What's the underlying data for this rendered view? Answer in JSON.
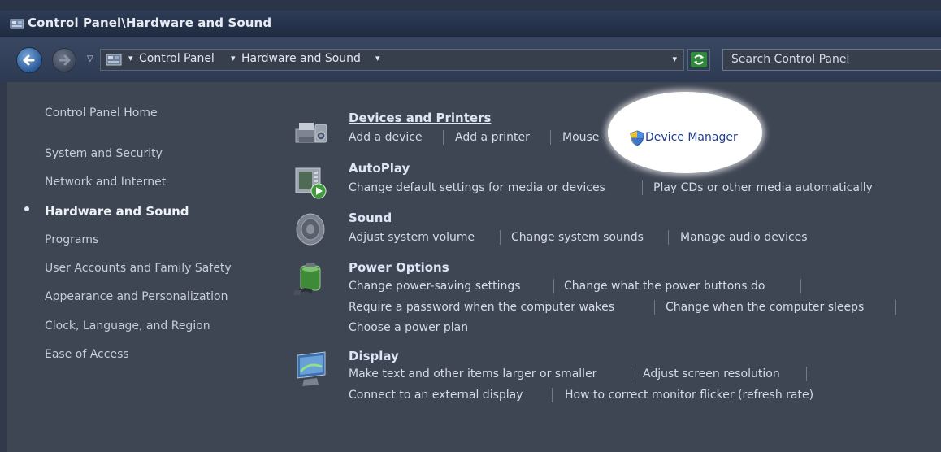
{
  "window": {
    "title": "Control Panel\\Hardware and Sound"
  },
  "address": {
    "crumbs": [
      "Control Panel",
      "Hardware and Sound"
    ],
    "search_placeholder": "Search Control Panel"
  },
  "sidebar": {
    "home": "Control Panel Home",
    "items": [
      {
        "label": "System and Security"
      },
      {
        "label": "Network and Internet"
      },
      {
        "label": "Hardware and Sound",
        "current": true
      },
      {
        "label": "Programs"
      },
      {
        "label": "User Accounts and Family Safety"
      },
      {
        "label": "Appearance and Personalization"
      },
      {
        "label": "Clock, Language, and Region"
      },
      {
        "label": "Ease of Access"
      }
    ]
  },
  "categories": [
    {
      "title": "Devices and Printers",
      "icon": "printer-icon",
      "links": [
        "Add a device",
        "Add a printer",
        "Mouse",
        "Device Manager"
      ]
    },
    {
      "title": "AutoPlay",
      "icon": "autoplay-icon",
      "links": [
        "Change default settings for media or devices",
        "Play CDs or other media automatically"
      ]
    },
    {
      "title": "Sound",
      "icon": "speaker-icon",
      "links": [
        "Adjust system volume",
        "Change system sounds",
        "Manage audio devices"
      ]
    },
    {
      "title": "Power Options",
      "icon": "battery-icon",
      "links": [
        "Change power-saving settings",
        "Change what the power buttons do",
        "Require a password when the computer wakes",
        "Change when the computer sleeps",
        "Choose a power plan"
      ]
    },
    {
      "title": "Display",
      "icon": "monitor-icon",
      "links": [
        "Make text and other items larger or smaller",
        "Adjust screen resolution",
        "Connect to an external display",
        "How to correct monitor flicker (refresh rate)"
      ]
    }
  ],
  "colors": {
    "dimmed_background": "#3e4553",
    "highlight": "#ffffff",
    "highlighted_link": "#1e3c8c"
  }
}
